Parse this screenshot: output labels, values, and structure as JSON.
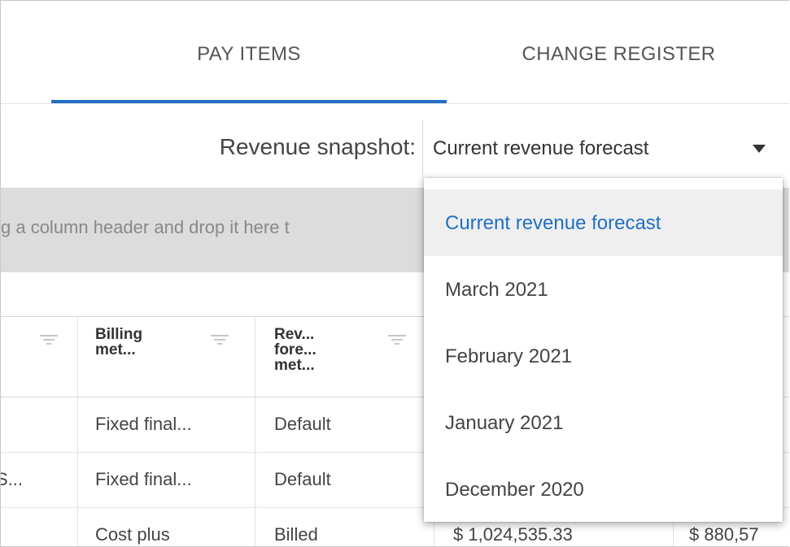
{
  "tabs": [
    {
      "label": "PAY ITEMS"
    },
    {
      "label": "CHANGE REGISTER"
    }
  ],
  "snapshot": {
    "label": "Revenue snapshot:",
    "selected": "Current revenue forecast",
    "options": [
      {
        "label": "Current revenue forecast"
      },
      {
        "label": "March 2021"
      },
      {
        "label": "February 2021"
      },
      {
        "label": "January 2021"
      },
      {
        "label": "December 2020"
      }
    ]
  },
  "group_zone": {
    "text": "g a column header and drop it here t"
  },
  "grid": {
    "headers": [
      {
        "label": "Billing\nmet..."
      },
      {
        "label": "Rev...\nfore...\nmet..."
      }
    ],
    "rows": [
      {
        "c0": "",
        "billing": "Fixed final...",
        "rev": "Default",
        "c3": "",
        "c4": ""
      },
      {
        "c0": "S...",
        "billing": "Fixed final...",
        "rev": "Default",
        "c3": "",
        "c4": ""
      },
      {
        "c0": "",
        "billing": "Cost plus",
        "rev": "Billed",
        "c3": "$ 1,024,535.33",
        "c4": "$ 880,57"
      }
    ]
  },
  "colors": {
    "accent": "#1f6fc4",
    "group_zone_bg": "#dcdcdc"
  }
}
